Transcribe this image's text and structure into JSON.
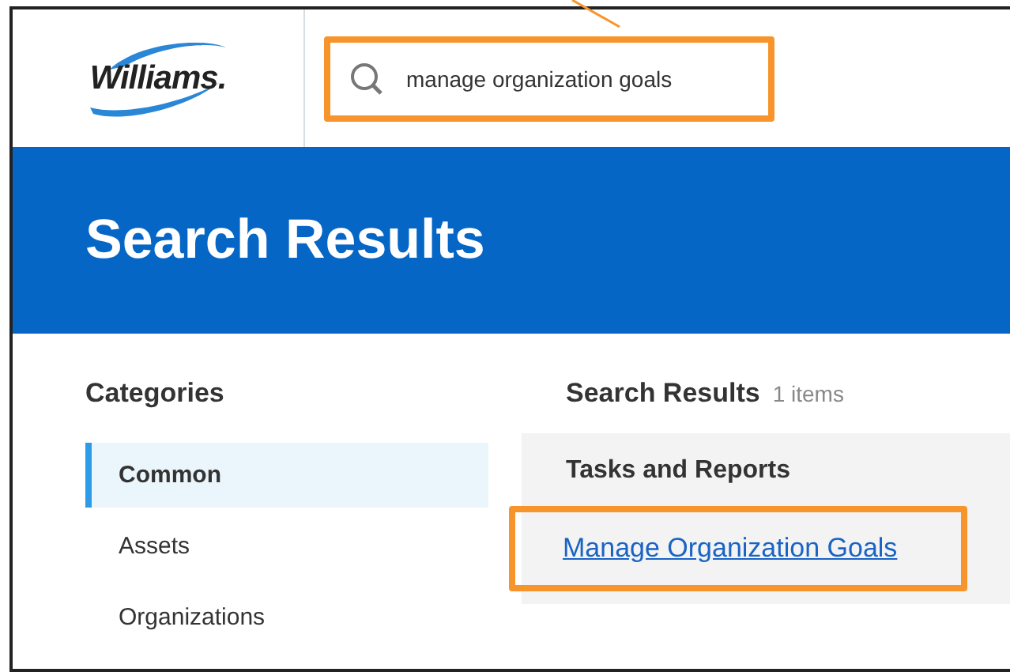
{
  "header": {
    "logo": "Williams.",
    "search": {
      "value": "manage organization goals",
      "highlighted": true
    }
  },
  "banner": {
    "title": "Search Results"
  },
  "categories": {
    "title": "Categories",
    "items": [
      {
        "label": "Common",
        "selected": true
      },
      {
        "label": "Assets",
        "selected": false
      },
      {
        "label": "Organizations",
        "selected": false
      }
    ]
  },
  "results": {
    "title": "Search Results",
    "count": "1 items",
    "group": "Tasks and Reports",
    "items": [
      {
        "label": "Manage Organization Goals",
        "highlighted": true
      }
    ]
  }
}
